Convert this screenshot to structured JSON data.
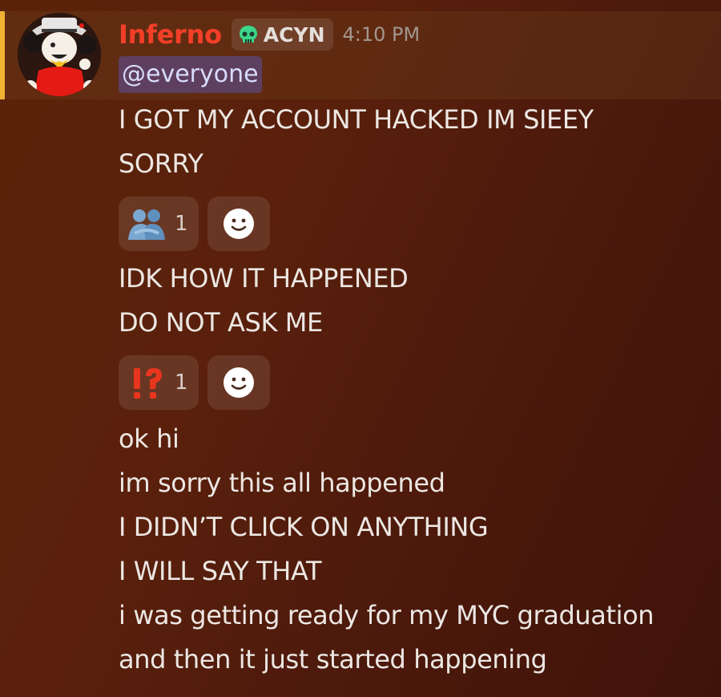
{
  "message": {
    "author": "Inferno",
    "server_tag": {
      "label": "ACYN",
      "icon": "skull-icon",
      "icon_color": "#3bd68a"
    },
    "timestamp": "4:10 PM",
    "mention": "@everyone",
    "lines_group_1": [
      "I GOT MY ACCOUNT HACKED IM SIEEY",
      "SORRY"
    ],
    "reactions_1": {
      "emoji": "people-hugging-emoji",
      "count": "1"
    },
    "lines_group_2": [
      "IDK HOW IT HAPPENED",
      "DO NOT ASK ME"
    ],
    "reactions_2": {
      "emoji": "exclamation-question-emoji",
      "count": "1"
    },
    "lines_group_3": [
      "ok hi",
      "im sorry this all happened",
      "I DIDN’T CLICK ON ANYTHING",
      "I WILL SAY THAT",
      "i was getting ready for my MYC graduation",
      "and then it just started happening"
    ]
  },
  "colors": {
    "username": "#f23f28",
    "highlight_bar": "#f0b232",
    "mention_bg": "#5865f2",
    "background": "#5a200c"
  }
}
